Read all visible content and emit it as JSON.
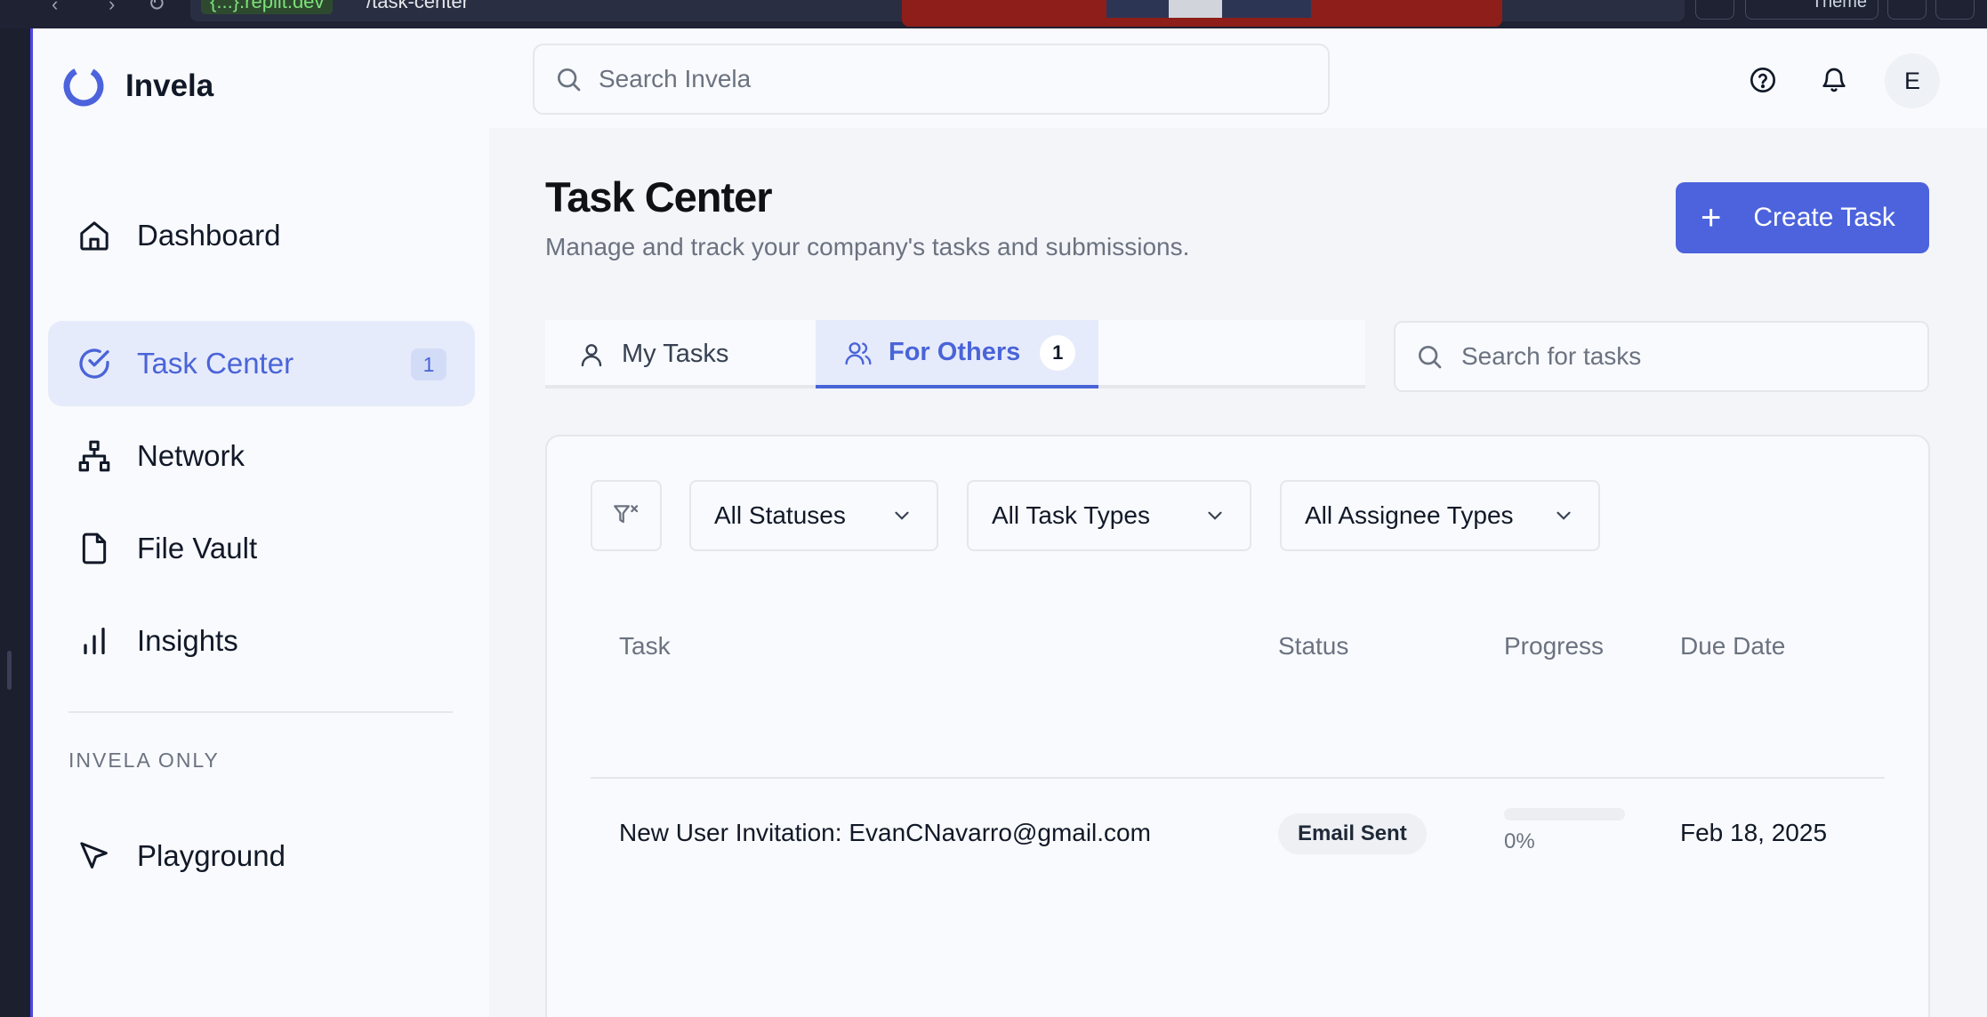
{
  "browser": {
    "url_domain": "{...}.replit.dev",
    "url_path": "/task-center",
    "theme_label": "Theme"
  },
  "app": {
    "name": "Invela"
  },
  "search": {
    "placeholder": "Search Invela"
  },
  "user": {
    "initial": "E"
  },
  "sidebar": {
    "items": [
      {
        "label": "Dashboard",
        "icon": "home-icon"
      },
      {
        "label": "Task Center",
        "icon": "check-circle-icon",
        "badge": "1",
        "active": true
      },
      {
        "label": "Network",
        "icon": "network-icon"
      },
      {
        "label": "File Vault",
        "icon": "file-icon"
      },
      {
        "label": "Insights",
        "icon": "bar-chart-icon"
      }
    ],
    "section_label": "INVELA ONLY",
    "extra_items": [
      {
        "label": "Playground",
        "icon": "cursor-icon"
      }
    ]
  },
  "page": {
    "title": "Task Center",
    "subtitle": "Manage and track your company's tasks and submissions.",
    "create_button": "Create Task"
  },
  "tabs": [
    {
      "label": "My Tasks",
      "icon": "user-icon"
    },
    {
      "label": "For Others",
      "icon": "users-icon",
      "count": "1",
      "active": true
    }
  ],
  "task_search": {
    "placeholder": "Search for tasks"
  },
  "filters": [
    {
      "label": "All Statuses"
    },
    {
      "label": "All Task Types"
    },
    {
      "label": "All Assignee Types"
    }
  ],
  "table": {
    "headers": [
      "Task",
      "Status",
      "Progress",
      "Due Date"
    ],
    "rows": [
      {
        "task": "New User Invitation: EvanCNavarro@gmail.com",
        "status": "Email Sent",
        "progress": "0%",
        "progress_value": 0,
        "due": "Feb 18, 2025"
      }
    ]
  },
  "colors": {
    "accent": "#4c63dd",
    "active_bg": "#e6ebfb",
    "active_text": "#4a64d8"
  }
}
